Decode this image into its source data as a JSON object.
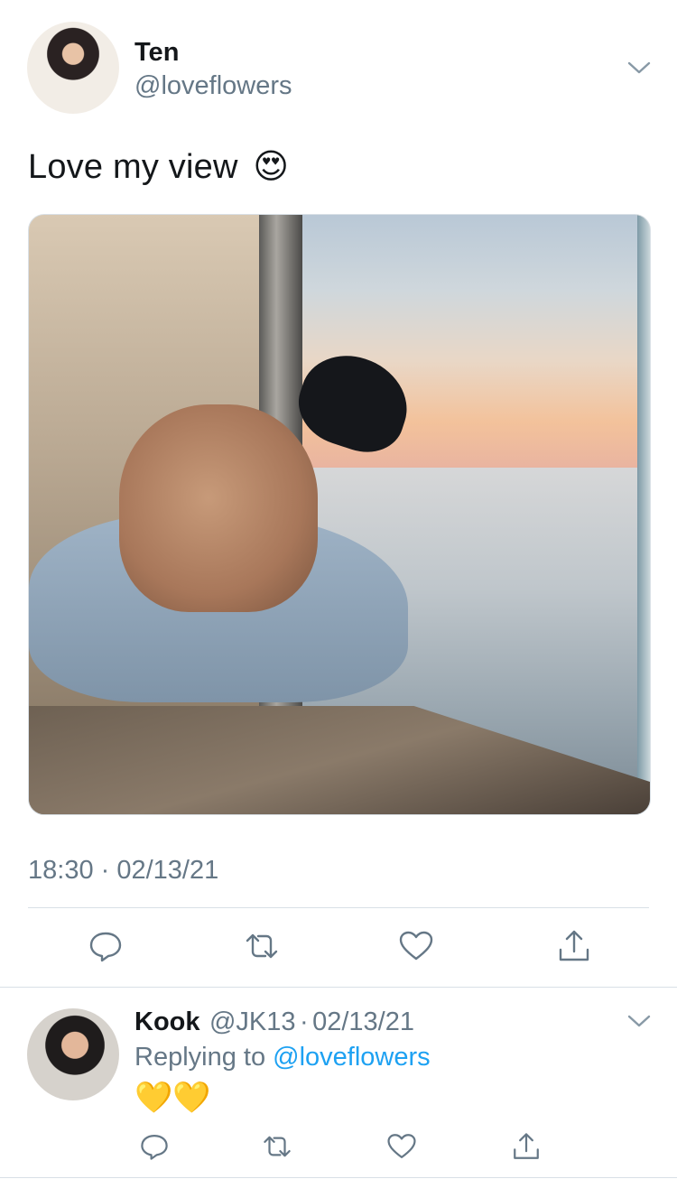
{
  "main_tweet": {
    "name": "Ten",
    "handle": "@loveflowers",
    "text": "Love my view",
    "emoji": "😍",
    "timestamp": "18:30 · 02/13/21"
  },
  "reply": {
    "name": "Kook",
    "handle": "@JK13",
    "separator": "·",
    "date": "02/13/21",
    "replying_prefix": "Replying to",
    "replying_to": "@loveflowers",
    "text": "💛💛"
  },
  "icons": {
    "reply": "speech-bubble-icon",
    "retweet": "retweet-icon",
    "like": "heart-icon",
    "share": "share-icon",
    "more": "chevron-down-icon"
  },
  "colors": {
    "link": "#1da1f2",
    "secondary": "#657786",
    "primary": "#14171a",
    "divider": "#d9e0e6"
  }
}
